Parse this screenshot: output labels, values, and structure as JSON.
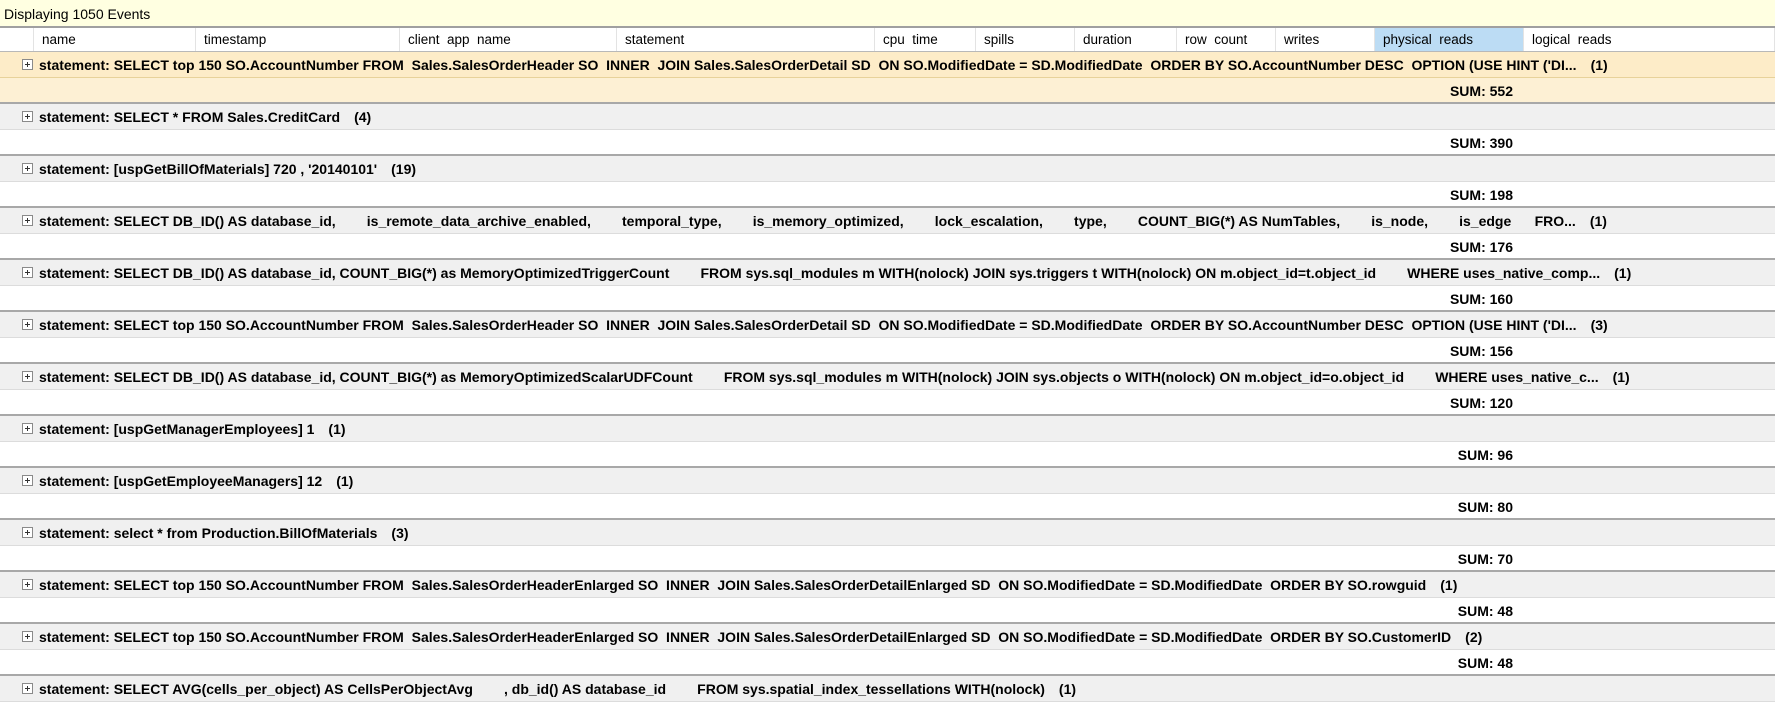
{
  "title": "Displaying 1050 Events",
  "columns": [
    "name",
    "timestamp",
    "client  app  name",
    "statement",
    "cpu  time",
    "spills",
    "duration",
    "row  count",
    "writes",
    "physical  reads",
    "logical  reads"
  ],
  "selected_column": "physical  reads",
  "statement_prefix": "statement: ",
  "sum_prefix": "SUM: ",
  "groups": [
    {
      "statement": "SELECT top 150 SO.AccountNumber FROM  Sales.SalesOrderHeader SO  INNER  JOIN Sales.SalesOrderDetail SD  ON SO.ModifiedDate = SD.ModifiedDate  ORDER BY SO.AccountNumber DESC  OPTION (USE HINT ('DI...",
      "count": "(1)",
      "sum": "552",
      "selected": true
    },
    {
      "statement": "SELECT * FROM Sales.CreditCard",
      "count": "(4)",
      "sum": "390"
    },
    {
      "statement": "[uspGetBillOfMaterials] 720 , '20140101'",
      "count": "(19)",
      "sum": "198"
    },
    {
      "statement": "SELECT DB_ID() AS database_id,        is_remote_data_archive_enabled,        temporal_type,        is_memory_optimized,        lock_escalation,        type,        COUNT_BIG(*) AS NumTables,        is_node,        is_edge      FRO...",
      "count": "(1)",
      "sum": "176"
    },
    {
      "statement": "SELECT DB_ID() AS database_id, COUNT_BIG(*) as MemoryOptimizedTriggerCount        FROM sys.sql_modules m WITH(nolock) JOIN sys.triggers t WITH(nolock) ON m.object_id=t.object_id        WHERE uses_native_comp...",
      "count": "(1)",
      "sum": "160"
    },
    {
      "statement": "SELECT top 150 SO.AccountNumber FROM  Sales.SalesOrderHeader SO  INNER  JOIN Sales.SalesOrderDetail SD  ON SO.ModifiedDate = SD.ModifiedDate  ORDER BY SO.AccountNumber DESC  OPTION (USE HINT ('DI...",
      "count": "(3)",
      "sum": "156"
    },
    {
      "statement": "SELECT DB_ID() AS database_id, COUNT_BIG(*) as MemoryOptimizedScalarUDFCount        FROM sys.sql_modules m WITH(nolock) JOIN sys.objects o WITH(nolock) ON m.object_id=o.object_id        WHERE uses_native_c...",
      "count": "(1)",
      "sum": "120"
    },
    {
      "statement": "[uspGetManagerEmployees] 1",
      "count": "(1)",
      "sum": "96"
    },
    {
      "statement": "[uspGetEmployeeManagers] 12",
      "count": "(1)",
      "sum": "80"
    },
    {
      "statement": "select * from Production.BillOfMaterials",
      "count": "(3)",
      "sum": "70"
    },
    {
      "statement": "SELECT top 150 SO.AccountNumber FROM  Sales.SalesOrderHeaderEnlarged SO  INNER  JOIN Sales.SalesOrderDetailEnlarged SD  ON SO.ModifiedDate = SD.ModifiedDate  ORDER BY SO.rowguid",
      "count": "(1)",
      "sum": "48"
    },
    {
      "statement": "SELECT top 150 SO.AccountNumber FROM  Sales.SalesOrderHeaderEnlarged SO  INNER  JOIN Sales.SalesOrderDetailEnlarged SD  ON SO.ModifiedDate = SD.ModifiedDate  ORDER BY SO.CustomerID",
      "count": "(2)",
      "sum": "48"
    },
    {
      "statement": "SELECT AVG(cells_per_object) AS CellsPerObjectAvg        , db_id() AS database_id        FROM sys.spatial_index_tessellations WITH(nolock)",
      "count": "(1)",
      "sum": null
    }
  ]
}
